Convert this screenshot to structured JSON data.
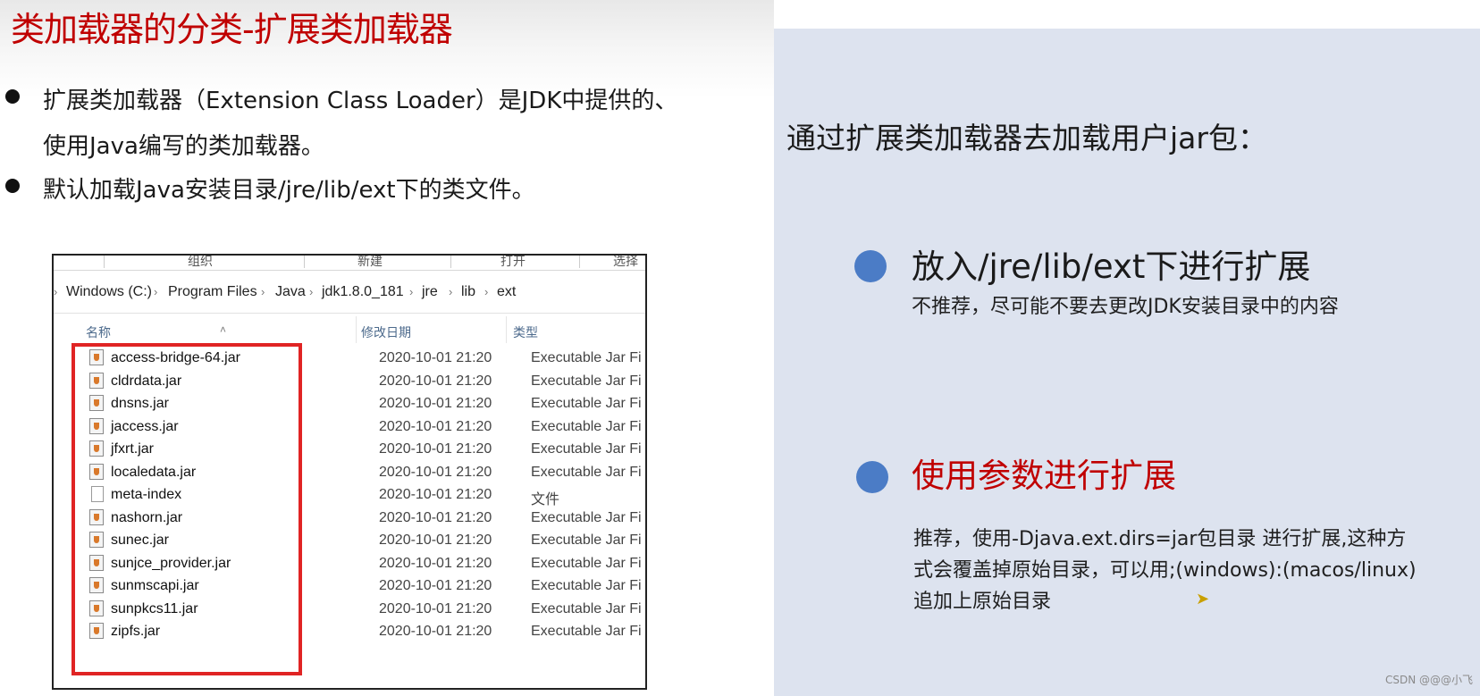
{
  "slide": {
    "title": "类加载器的分类-扩展类加载器",
    "bullets": [
      {
        "line1": "扩展类加载器（Extension Class Loader）是JDK中提供的、",
        "line2": "使用Java编写的类加载器。"
      },
      {
        "line1": "默认加载Java安装目录/jre/lib/ext下的类文件。"
      }
    ]
  },
  "explorer": {
    "ribbon": [
      "组织",
      "新建",
      "打开",
      "选择"
    ],
    "breadcrumb": [
      "Windows (C:)",
      "Program Files",
      "Java",
      "jdk1.8.0_181",
      "jre",
      "lib",
      "ext"
    ],
    "columns": [
      "名称",
      "修改日期",
      "类型"
    ],
    "files": [
      {
        "name": "access-bridge-64.jar",
        "date": "2020-10-01 21:20",
        "type": "Executable Jar Fi",
        "icon": "jar-file-icon"
      },
      {
        "name": "cldrdata.jar",
        "date": "2020-10-01 21:20",
        "type": "Executable Jar Fi",
        "icon": "jar-file-icon"
      },
      {
        "name": "dnsns.jar",
        "date": "2020-10-01 21:20",
        "type": "Executable Jar Fi",
        "icon": "jar-file-icon"
      },
      {
        "name": "jaccess.jar",
        "date": "2020-10-01 21:20",
        "type": "Executable Jar Fi",
        "icon": "jar-file-icon"
      },
      {
        "name": "jfxrt.jar",
        "date": "2020-10-01 21:20",
        "type": "Executable Jar Fi",
        "icon": "jar-file-icon"
      },
      {
        "name": "localedata.jar",
        "date": "2020-10-01 21:20",
        "type": "Executable Jar Fi",
        "icon": "jar-file-icon"
      },
      {
        "name": "meta-index",
        "date": "2020-10-01 21:20",
        "type": "文件",
        "icon": "file-icon"
      },
      {
        "name": "nashorn.jar",
        "date": "2020-10-01 21:20",
        "type": "Executable Jar Fi",
        "icon": "jar-file-icon"
      },
      {
        "name": "sunec.jar",
        "date": "2020-10-01 21:20",
        "type": "Executable Jar Fi",
        "icon": "jar-file-icon"
      },
      {
        "name": "sunjce_provider.jar",
        "date": "2020-10-01 21:20",
        "type": "Executable Jar Fi",
        "icon": "jar-file-icon"
      },
      {
        "name": "sunmscapi.jar",
        "date": "2020-10-01 21:20",
        "type": "Executable Jar Fi",
        "icon": "jar-file-icon"
      },
      {
        "name": "sunpkcs11.jar",
        "date": "2020-10-01 21:20",
        "type": "Executable Jar Fi",
        "icon": "jar-file-icon"
      },
      {
        "name": "zipfs.jar",
        "date": "2020-10-01 21:20",
        "type": "Executable Jar Fi",
        "icon": "jar-file-icon"
      }
    ]
  },
  "right_panel": {
    "heading": "通过扩展类加载器去加载用户jar包：",
    "option1": {
      "title": "放入/jre/lib/ext下进行扩展",
      "desc": "不推荐，尽可能不要去更改JDK安装目录中的内容"
    },
    "option2": {
      "title": "使用参数进行扩展",
      "desc_lines": [
        "推荐，使用-Djava.ext.dirs=jar包目录 进行扩展,这种方",
        "式会覆盖掉原始目录，可以用;(windows):(macos/linux)",
        "追加上原始目录"
      ]
    }
  },
  "watermark": "CSDN @@@小飞",
  "colors": {
    "title_red": "#c00000",
    "panel_bg": "#dde3ef",
    "dot_blue": "#4b7cc6",
    "highlight_red": "#e02424"
  }
}
